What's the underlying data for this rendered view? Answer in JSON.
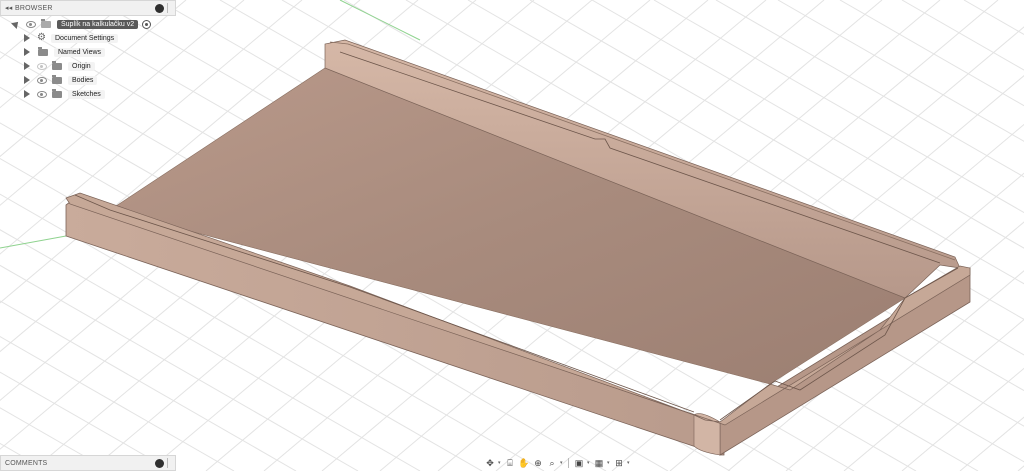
{
  "browser": {
    "header": "BROWSER",
    "root": {
      "label": "Šuplík na kalkulačku v2"
    },
    "items": [
      {
        "label": "Document Settings",
        "icon": "gear-icon"
      },
      {
        "label": "Named Views",
        "icon": "folder-icon"
      },
      {
        "label": "Origin",
        "icon": "folder-icon",
        "visibility": "hidden"
      },
      {
        "label": "Bodies",
        "icon": "folder-icon",
        "visibility": "visible"
      },
      {
        "label": "Sketches",
        "icon": "folder-icon",
        "visibility": "visible"
      }
    ]
  },
  "comments": {
    "header": "COMMENTS"
  },
  "toolbar": {
    "items": [
      "orbit-icon",
      "look-at-icon",
      "pan-icon",
      "zoom-icon",
      "fit-icon",
      "display-settings-icon",
      "visual-style-icon",
      "grid-settings-icon"
    ]
  },
  "colors": {
    "model_top": "#a68a7c",
    "model_side": "#c7a998",
    "grid": "#e3e3e3",
    "axis_green": "#7fd07f"
  }
}
